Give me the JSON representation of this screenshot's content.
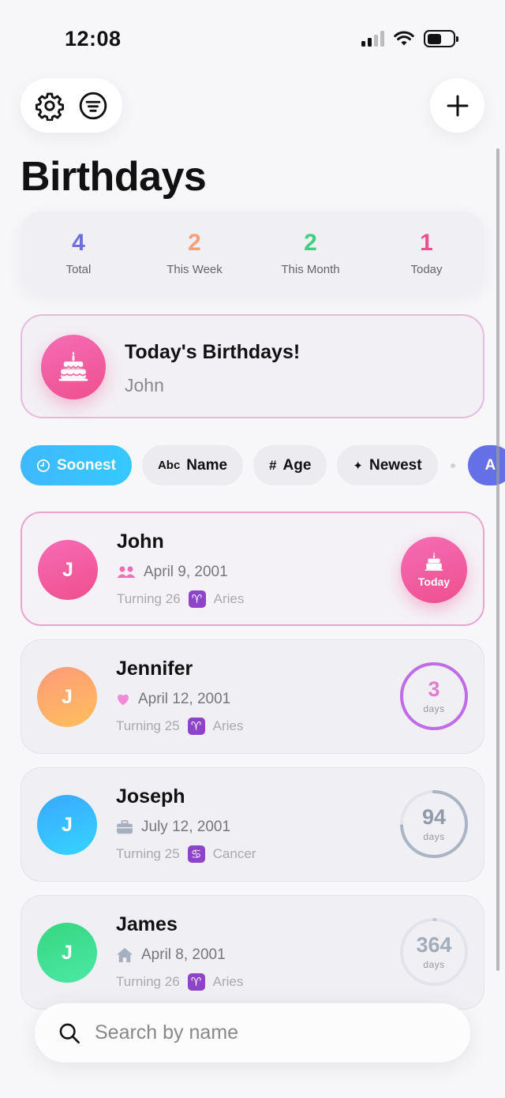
{
  "status_bar": {
    "time": "12:08"
  },
  "header": {
    "title": "Birthdays"
  },
  "stats": [
    {
      "value": "4",
      "label": "Total",
      "color": "#6b6fd6"
    },
    {
      "value": "2",
      "label": "This Week",
      "color": "#f4a07a"
    },
    {
      "value": "2",
      "label": "This Month",
      "color": "#3fcf7f"
    },
    {
      "value": "1",
      "label": "Today",
      "color": "#ec4f8e"
    }
  ],
  "today_banner": {
    "title": "Today's Birthdays!",
    "names": "John"
  },
  "sort_chips": [
    {
      "glyph": "◷",
      "label": "Soonest",
      "active": true
    },
    {
      "glyph": "Abc",
      "label": "Name"
    },
    {
      "glyph": "#",
      "label": "Age"
    },
    {
      "glyph": "✦",
      "label": "Newest"
    },
    {
      "glyph": "",
      "label": "A"
    }
  ],
  "people": [
    {
      "initial": "J",
      "name": "John",
      "date": "April 9, 2001",
      "relation_icon": "friends-icon",
      "turning": "Turning 26",
      "zodiac_symbol": "♈",
      "zodiac": "Aries",
      "badge": "Today",
      "avatar_gradient": [
        "#f76bb6",
        "#ef4f8c"
      ]
    },
    {
      "initial": "J",
      "name": "Jennifer",
      "date": "April 12, 2001",
      "relation_icon": "heart-icon",
      "turning": "Turning 25",
      "zodiac_symbol": "♈",
      "zodiac": "Aries",
      "days": "3",
      "days_unit": "days",
      "progress": 0.99,
      "ring_color": "#c06be8",
      "num_color": "#e07fcf",
      "avatar_gradient": [
        "#ff9a7a",
        "#fdbf5c"
      ]
    },
    {
      "initial": "J",
      "name": "Joseph",
      "date": "July 12, 2001",
      "relation_icon": "briefcase-icon",
      "turning": "Turning 25",
      "zodiac_symbol": "♋",
      "zodiac": "Cancer",
      "days": "94",
      "days_unit": "days",
      "progress": 0.74,
      "ring_color": "#a9b4c4",
      "num_color": "#8f9aab",
      "avatar_gradient": [
        "#3aa8ff",
        "#35d4ff"
      ]
    },
    {
      "initial": "J",
      "name": "James",
      "date": "April 8, 2001",
      "relation_icon": "home-icon",
      "turning": "Turning 26",
      "zodiac_symbol": "♈",
      "zodiac": "Aries",
      "days": "364",
      "days_unit": "days",
      "progress": 0.003,
      "ring_color": "#c2c8d2",
      "num_color": "#a3acba",
      "avatar_gradient": [
        "#36d67f",
        "#4be8a6"
      ]
    }
  ],
  "search": {
    "placeholder": "Search by name"
  }
}
